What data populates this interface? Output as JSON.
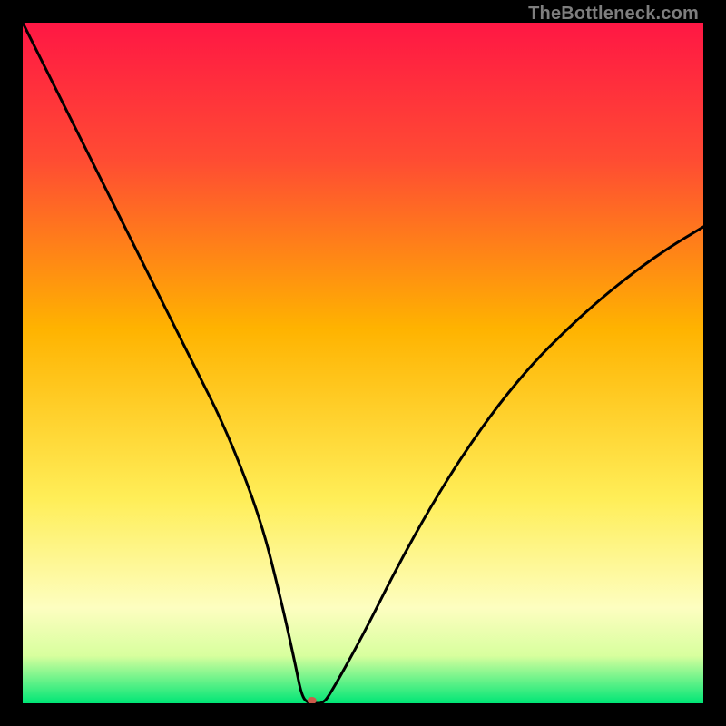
{
  "watermark": "TheBottleneck.com",
  "chart_data": {
    "type": "line",
    "title": "",
    "xlabel": "",
    "ylabel": "",
    "xlim": [
      0,
      100
    ],
    "ylim": [
      0,
      100
    ],
    "grid": false,
    "legend": false,
    "gradient_stops": [
      {
        "offset": 0.0,
        "color": "#ff1744"
      },
      {
        "offset": 0.2,
        "color": "#ff4b33"
      },
      {
        "offset": 0.45,
        "color": "#ffb300"
      },
      {
        "offset": 0.7,
        "color": "#ffee58"
      },
      {
        "offset": 0.86,
        "color": "#fdfec0"
      },
      {
        "offset": 0.93,
        "color": "#d8ff9e"
      },
      {
        "offset": 1.0,
        "color": "#00e676"
      }
    ],
    "series": [
      {
        "name": "bottleneck-curve",
        "stroke": "#000000",
        "stroke_width": 3,
        "x": [
          0,
          5,
          10,
          15,
          20,
          25,
          30,
          35,
          38,
          40,
          41,
          42,
          43,
          44,
          45,
          50,
          55,
          60,
          65,
          70,
          75,
          80,
          85,
          90,
          95,
          100
        ],
        "y": [
          100,
          90,
          80,
          70,
          60,
          50,
          40,
          27,
          15,
          6,
          1,
          0,
          0,
          0,
          1,
          10,
          20,
          29,
          37,
          44,
          50,
          55,
          59.5,
          63.5,
          67,
          70
        ]
      }
    ],
    "marker": {
      "name": "optimal-point",
      "x": 42.5,
      "y": 0,
      "rx": 5,
      "ry": 4,
      "fill": "#cc5a4a"
    }
  }
}
